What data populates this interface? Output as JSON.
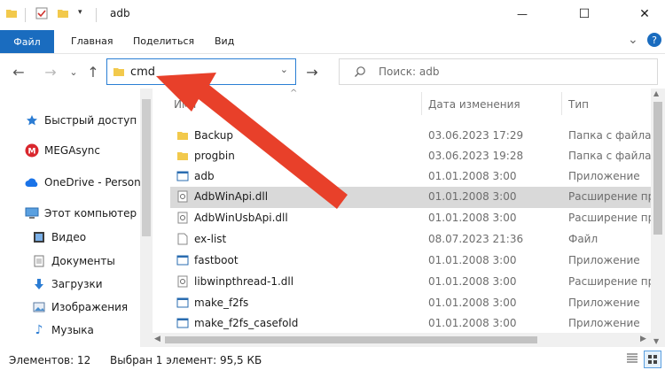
{
  "window": {
    "title": "adb",
    "minimize_glyph": "—",
    "maximize_glyph": "☐",
    "close_glyph": "✕"
  },
  "ribbon": {
    "tabs": [
      "Файл",
      "Главная",
      "Поделиться",
      "Вид"
    ],
    "collapse_glyph": "⌄",
    "help_glyph": "?"
  },
  "toolbar": {
    "back_glyph": "←",
    "forward_glyph": "→",
    "recent_glyph": "⌄",
    "up_glyph": "↑",
    "address_value": "cmd",
    "address_dropdown_glyph": "⌄",
    "go_glyph": "→",
    "search_placeholder": "Поиск: adb"
  },
  "navigation": [
    {
      "label": "Быстрый доступ",
      "icon": "star-icon"
    },
    {
      "label": "MEGAsync",
      "icon": "mega-icon"
    },
    {
      "label": "OneDrive - Person",
      "icon": "cloud-icon"
    },
    {
      "label": "Этот компьютер",
      "icon": "computer-icon"
    },
    {
      "label": "Видео",
      "icon": "video-icon"
    },
    {
      "label": "Документы",
      "icon": "documents-icon"
    },
    {
      "label": "Загрузки",
      "icon": "download-icon"
    },
    {
      "label": "Изображения",
      "icon": "images-icon"
    },
    {
      "label": "Музыка",
      "icon": "music-icon"
    }
  ],
  "columns": {
    "name": "Имя",
    "date": "Дата изменения",
    "type": "Тип",
    "sort_glyph": "^"
  },
  "files": [
    {
      "name": "Backup",
      "date": "03.06.2023 17:29",
      "type": "Папка с файлами",
      "icon": "folder-icon",
      "selected": false
    },
    {
      "name": "progbin",
      "date": "03.06.2023 19:28",
      "type": "Папка с файлами",
      "icon": "folder-icon",
      "selected": false
    },
    {
      "name": "adb",
      "date": "01.01.2008 3:00",
      "type": "Приложение",
      "icon": "application-icon",
      "selected": false
    },
    {
      "name": "AdbWinApi.dll",
      "date": "01.01.2008 3:00",
      "type": "Расширение приложения",
      "icon": "dll-icon",
      "selected": true
    },
    {
      "name": "AdbWinUsbApi.dll",
      "date": "01.01.2008 3:00",
      "type": "Расширение приложения",
      "icon": "dll-icon",
      "selected": false
    },
    {
      "name": "ex-list",
      "date": "08.07.2023 21:36",
      "type": "Файл",
      "icon": "file-icon",
      "selected": false
    },
    {
      "name": "fastboot",
      "date": "01.01.2008 3:00",
      "type": "Приложение",
      "icon": "application-icon",
      "selected": false
    },
    {
      "name": "libwinpthread-1.dll",
      "date": "01.01.2008 3:00",
      "type": "Расширение приложения",
      "icon": "dll-icon",
      "selected": false
    },
    {
      "name": "make_f2fs",
      "date": "01.01.2008 3:00",
      "type": "Приложение",
      "icon": "application-icon",
      "selected": false
    },
    {
      "name": "make_f2fs_casefold",
      "date": "01.01.2008 3:00",
      "type": "Приложение",
      "icon": "application-icon",
      "selected": false
    }
  ],
  "status": {
    "count": "Элементов: 12",
    "selection": "Выбран 1 элемент: 95,5 КБ"
  },
  "annotation": {
    "color": "#e8402a"
  },
  "colors": {
    "accent": "#1a6cbf",
    "folder": "#f2c94c",
    "selection": "#d9d9d9"
  }
}
